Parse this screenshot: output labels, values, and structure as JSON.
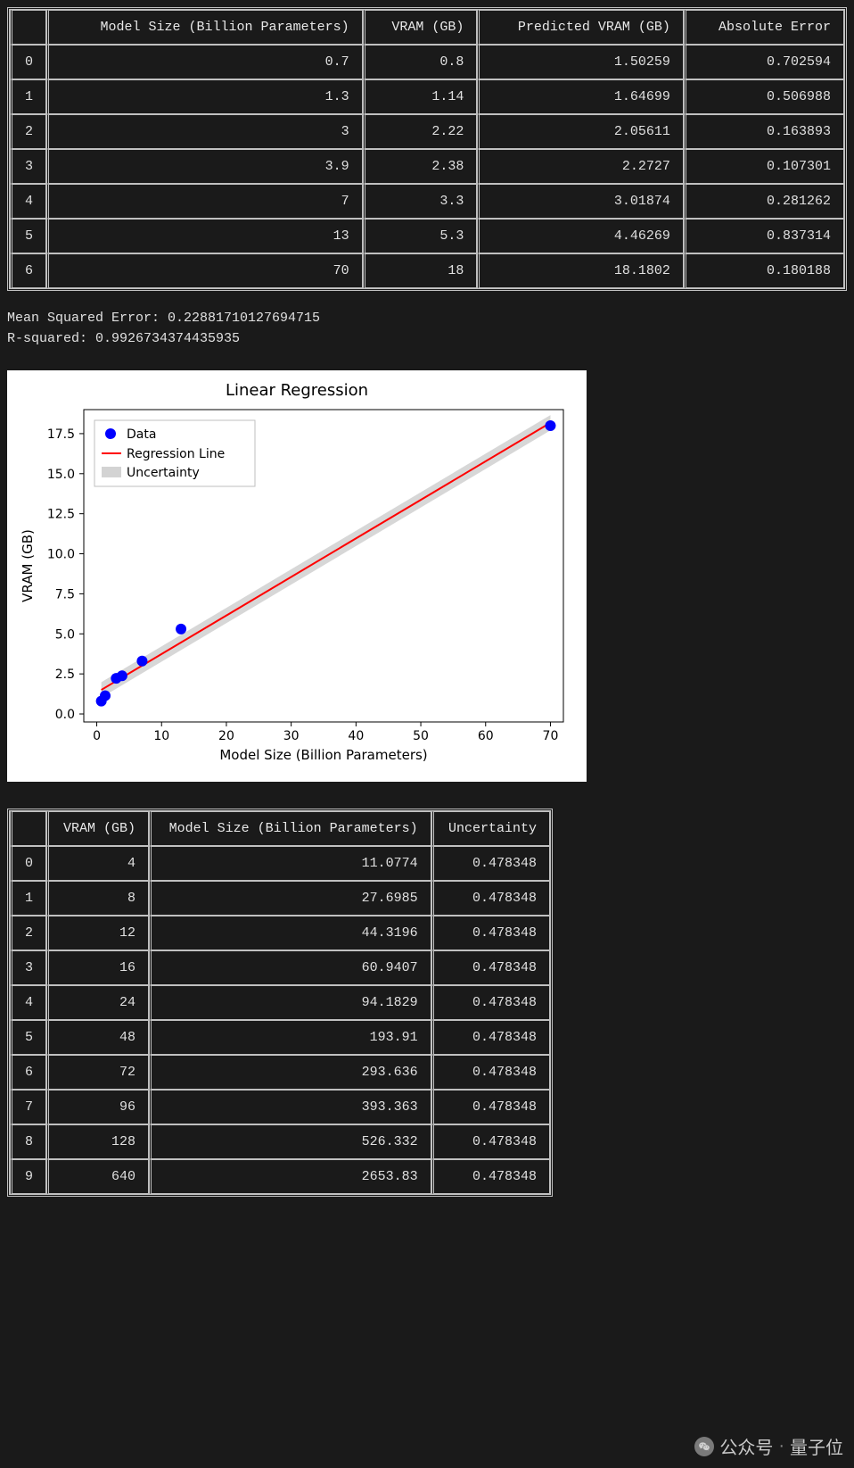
{
  "table1": {
    "headers": [
      "",
      "Model Size (Billion Parameters)",
      "VRAM (GB)",
      "Predicted VRAM (GB)",
      "Absolute Error"
    ],
    "rows": [
      {
        "idx": "0",
        "model": "0.7",
        "vram": "0.8",
        "pred": "1.50259",
        "err": "0.702594"
      },
      {
        "idx": "1",
        "model": "1.3",
        "vram": "1.14",
        "pred": "1.64699",
        "err": "0.506988"
      },
      {
        "idx": "2",
        "model": "3",
        "vram": "2.22",
        "pred": "2.05611",
        "err": "0.163893"
      },
      {
        "idx": "3",
        "model": "3.9",
        "vram": "2.38",
        "pred": "2.2727",
        "err": "0.107301"
      },
      {
        "idx": "4",
        "model": "7",
        "vram": "3.3",
        "pred": "3.01874",
        "err": "0.281262"
      },
      {
        "idx": "5",
        "model": "13",
        "vram": "5.3",
        "pred": "4.46269",
        "err": "0.837314"
      },
      {
        "idx": "6",
        "model": "70",
        "vram": "18",
        "pred": "18.1802",
        "err": "0.180188"
      }
    ]
  },
  "stats": {
    "mse_label": "Mean Squared Error: ",
    "mse_value": "0.22881710127694715",
    "r2_label": "R-squared: ",
    "r2_value": "0.9926734374435935"
  },
  "chart_data": {
    "type": "scatter+line",
    "title": "Linear Regression",
    "xlabel": "Model Size (Billion Parameters)",
    "ylabel": "VRAM (GB)",
    "xlim": [
      -2,
      72
    ],
    "ylim": [
      -0.5,
      19
    ],
    "xticks": [
      0,
      10,
      20,
      30,
      40,
      50,
      60,
      70
    ],
    "yticks": [
      0.0,
      2.5,
      5.0,
      7.5,
      10.0,
      12.5,
      15.0,
      17.5
    ],
    "legend": [
      "Data",
      "Regression Line",
      "Uncertainty"
    ],
    "series": [
      {
        "name": "Data",
        "type": "scatter",
        "color": "#0000ff",
        "x": [
          0.7,
          1.3,
          3,
          3.9,
          7,
          13,
          70
        ],
        "y": [
          0.8,
          1.14,
          2.22,
          2.38,
          3.3,
          5.3,
          18
        ]
      },
      {
        "name": "Regression Line",
        "type": "line",
        "color": "#ff0000",
        "x": [
          0.7,
          70
        ],
        "y": [
          1.50259,
          18.1802
        ]
      },
      {
        "name": "Uncertainty",
        "type": "band",
        "color": "#d3d3d3",
        "band_half_width": 0.478348,
        "x": [
          0.7,
          70
        ],
        "y_center": [
          1.50259,
          18.1802
        ]
      }
    ]
  },
  "table2": {
    "headers": [
      "",
      "VRAM (GB)",
      "Model Size (Billion Parameters)",
      "Uncertainty"
    ],
    "rows": [
      {
        "idx": "0",
        "vram": "4",
        "model": "11.0774",
        "unc": "0.478348"
      },
      {
        "idx": "1",
        "vram": "8",
        "model": "27.6985",
        "unc": "0.478348"
      },
      {
        "idx": "2",
        "vram": "12",
        "model": "44.3196",
        "unc": "0.478348"
      },
      {
        "idx": "3",
        "vram": "16",
        "model": "60.9407",
        "unc": "0.478348"
      },
      {
        "idx": "4",
        "vram": "24",
        "model": "94.1829",
        "unc": "0.478348"
      },
      {
        "idx": "5",
        "vram": "48",
        "model": "193.91",
        "unc": "0.478348"
      },
      {
        "idx": "6",
        "vram": "72",
        "model": "293.636",
        "unc": "0.478348"
      },
      {
        "idx": "7",
        "vram": "96",
        "model": "393.363",
        "unc": "0.478348"
      },
      {
        "idx": "8",
        "vram": "128",
        "model": "526.332",
        "unc": "0.478348"
      },
      {
        "idx": "9",
        "vram": "640",
        "model": "2653.83",
        "unc": "0.478348"
      }
    ]
  },
  "watermark": {
    "prefix": "公众号",
    "dot": "·",
    "name": "量子位"
  }
}
